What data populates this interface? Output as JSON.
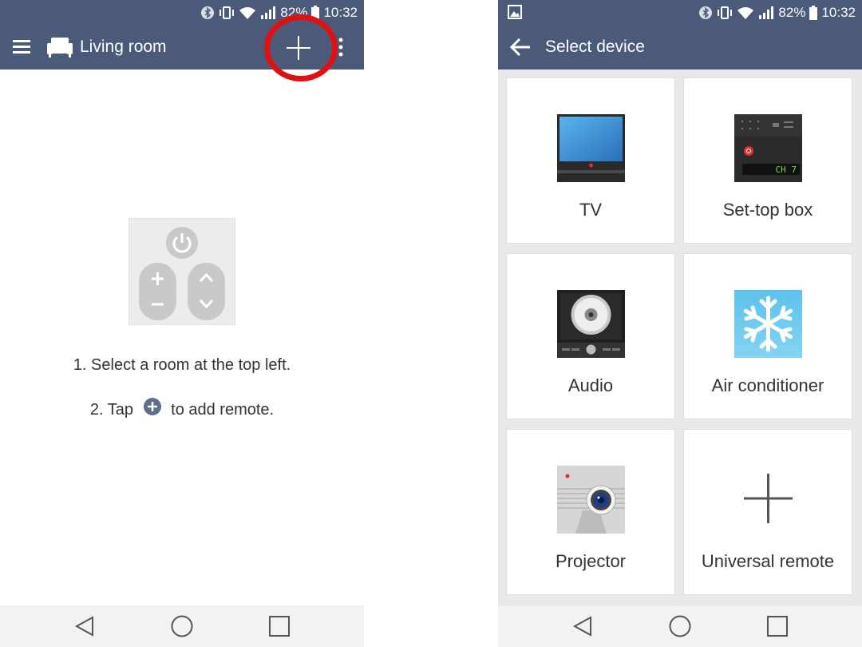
{
  "left": {
    "status": {
      "battery": "82%",
      "time": "10:32"
    },
    "appbar": {
      "room_title": "Living room"
    },
    "instructions": {
      "step1": "1. Select a room at the top left.",
      "step2_prefix": "2. Tap",
      "step2_suffix": "to add remote."
    }
  },
  "right": {
    "status": {
      "battery": "82%",
      "time": "10:32"
    },
    "appbar": {
      "title": "Select device"
    },
    "devices": [
      {
        "label": "TV",
        "icon": "tv-icon"
      },
      {
        "label": "Set-top box",
        "icon": "set-top-box-icon",
        "display_text": "CH 7"
      },
      {
        "label": "Audio",
        "icon": "audio-icon"
      },
      {
        "label": "Air conditioner",
        "icon": "snowflake-icon"
      },
      {
        "label": "Projector",
        "icon": "projector-icon"
      },
      {
        "label": "Universal remote",
        "icon": "plus-icon"
      }
    ]
  },
  "colors": {
    "appbar": "#4a5a78",
    "highlight": "#e01010",
    "grid_bg": "#e9e9e9"
  }
}
